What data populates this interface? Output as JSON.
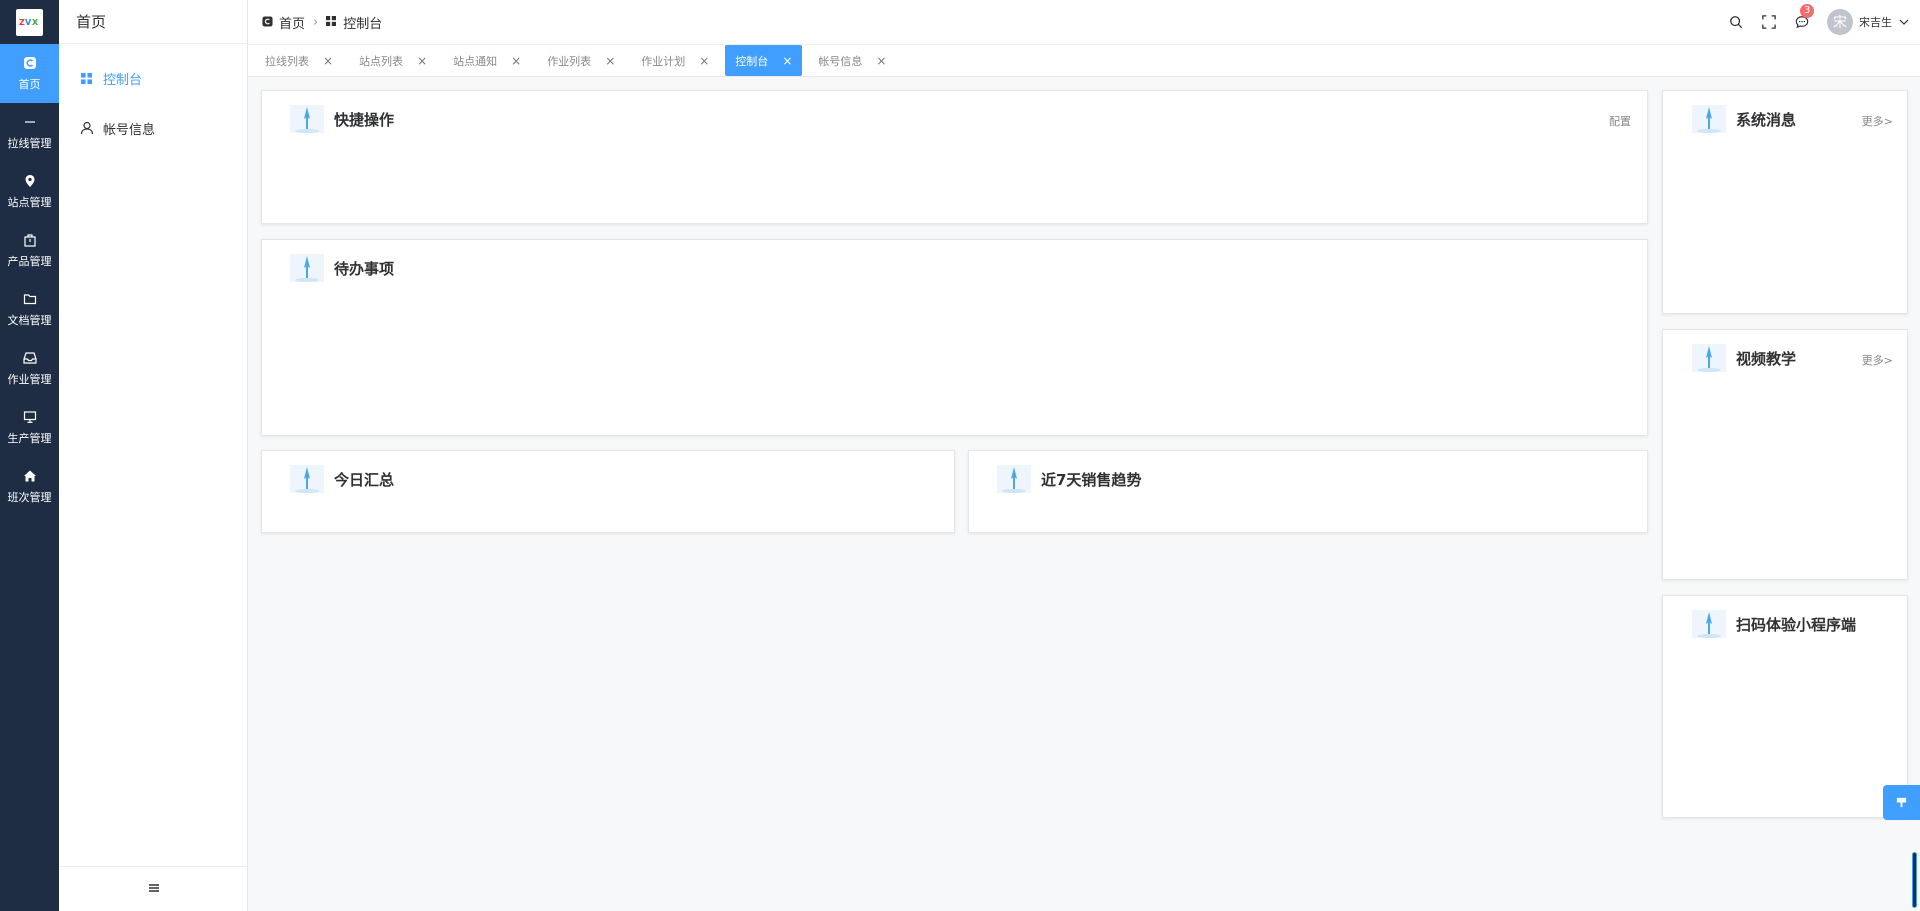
{
  "rail": {
    "logo_text": "ZVX",
    "items": [
      {
        "label": "首页",
        "icon": "home-c-icon"
      },
      {
        "label": "拉线管理",
        "icon": "line-icon"
      },
      {
        "label": "站点管理",
        "icon": "location-pin-icon"
      },
      {
        "label": "产品管理",
        "icon": "box-icon"
      },
      {
        "label": "文档管理",
        "icon": "folder-icon"
      },
      {
        "label": "作业管理",
        "icon": "inbox-icon"
      },
      {
        "label": "生产管理",
        "icon": "monitor-icon"
      },
      {
        "label": "班次管理",
        "icon": "house-icon"
      }
    ]
  },
  "sidebar": {
    "title": "首页",
    "items": [
      {
        "label": "控制台",
        "icon": "grid-icon"
      },
      {
        "label": "帐号信息",
        "icon": "user-icon"
      }
    ]
  },
  "header": {
    "breadcrumb": [
      {
        "label": "首页",
        "icon": "home-c-icon"
      },
      {
        "label": "控制台",
        "icon": "grid-icon"
      }
    ],
    "badge_count": "3",
    "avatar_initial": "宋",
    "user_name": "宋吉生"
  },
  "tabs": [
    {
      "label": "拉线列表"
    },
    {
      "label": "站点列表"
    },
    {
      "label": "站点通知"
    },
    {
      "label": "作业列表"
    },
    {
      "label": "作业计划"
    },
    {
      "label": "控制台"
    },
    {
      "label": "帐号信息"
    }
  ],
  "cards": {
    "quick": {
      "title": "快捷操作",
      "link": "配置"
    },
    "todo": {
      "title": "待办事项"
    },
    "today": {
      "title": "今日汇总"
    },
    "trend": {
      "title": "近7天销售趋势"
    },
    "sysmsg": {
      "title": "系统消息",
      "link": "更多>"
    },
    "video": {
      "title": "视频教学",
      "link": "更多>"
    },
    "miniapp": {
      "title": "扫码体验小程序端"
    }
  },
  "colors": {
    "accent": "#409eff",
    "rail_bg": "#1f2d44",
    "badge": "#f56c6c"
  }
}
